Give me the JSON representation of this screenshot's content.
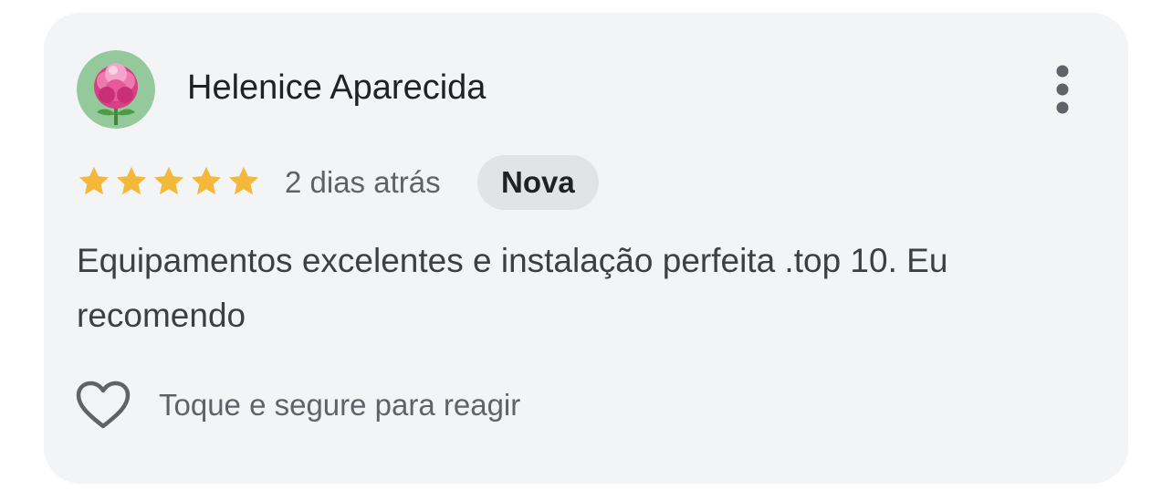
{
  "review": {
    "author_name": "Helenice Aparecida",
    "avatar_icon": "flower-avatar",
    "rating": 5,
    "rating_max": 5,
    "date": "2 dias atrás",
    "badge": "Nova",
    "text": "Equipamentos excelentes e instalação perfeita .top 10. Eu recomendo",
    "react_label": "Toque e segure para reagir",
    "react_icon": "heart-outline-icon",
    "menu_icon": "more-vert-icon"
  },
  "colors": {
    "card_background": "#f3f4f6",
    "star": "#f4b93a",
    "badge_background": "#e1e3e6",
    "icon_gray": "#5f6368"
  }
}
